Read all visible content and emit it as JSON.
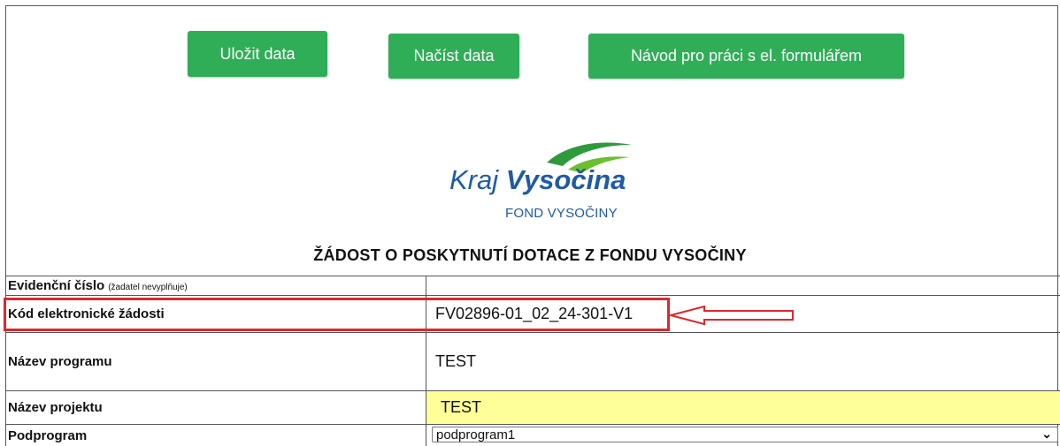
{
  "toolbar": {
    "save_label": "Uložit data",
    "load_label": "Načíst data",
    "guide_label": "Návod pro práci s el. formulářem"
  },
  "logo": {
    "brand_light": "Kraj",
    "brand_bold": "Vysočina",
    "subtitle": "FOND VYSOČINY"
  },
  "form": {
    "title": "ŽÁDOST O POSKYTNUTÍ DOTACE Z FONDU VYSOČINY",
    "rows": [
      {
        "label": "Evidenční číslo",
        "note": "(žadatel nevyplňuje)",
        "value": ""
      },
      {
        "label": "Kód elektronické žádosti",
        "value": "FV02896-01_02_24-301-V1"
      },
      {
        "label": "Název programu",
        "value": "TEST"
      },
      {
        "label": "Název projektu",
        "value": "TEST"
      },
      {
        "label": "Podprogram",
        "value": "podprogram1"
      }
    ]
  },
  "colors": {
    "button_green": "#2fae57",
    "brand_blue": "#1f5aa6",
    "highlight_red": "#e0262c",
    "input_yellow": "#ffff99"
  },
  "icons": {
    "logo_mark": "green-wave-logo",
    "arrow": "red-left-arrow",
    "select_chevron": "chevron-down-icon"
  }
}
